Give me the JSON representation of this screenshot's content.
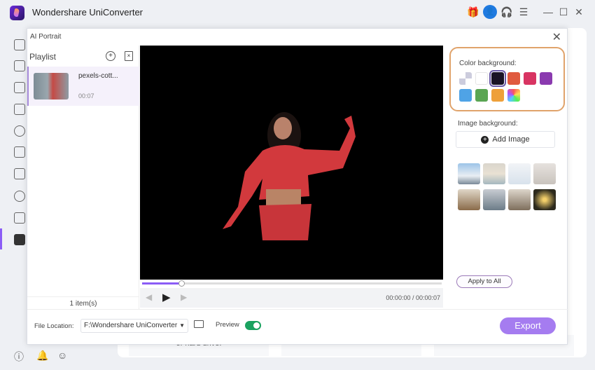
{
  "app": {
    "title": "Wondershare UniConverter"
  },
  "dialog": {
    "title": "AI Portrait"
  },
  "playlist": {
    "title": "Playlist",
    "items": [
      {
        "name": "pexels-cott...",
        "duration": "00:07"
      }
    ],
    "count": "1 item(s)"
  },
  "player": {
    "time": "00:00:00 / 00:00:07",
    "progress_percent": 13
  },
  "right_panel": {
    "color_label": "Color background:",
    "colors": [
      "transparent",
      "#ffffff",
      "#1a1426",
      "#e05a3f",
      "#d83462",
      "#8a3aaf",
      "#4fa3e6",
      "#5aa553",
      "#eea03a",
      "rainbow"
    ],
    "selected_color": "#1a1426",
    "image_label": "Image background:",
    "add_image": "Add Image",
    "apply_all": "Apply to All"
  },
  "bottom": {
    "file_location_label": "File Location:",
    "file_location": "F:\\Wondershare UniConverter",
    "preview_label": "Preview",
    "preview_on": true,
    "export": "Export"
  },
  "background": {
    "card_text": "or hard drive."
  },
  "accent": "#8b5cf6"
}
